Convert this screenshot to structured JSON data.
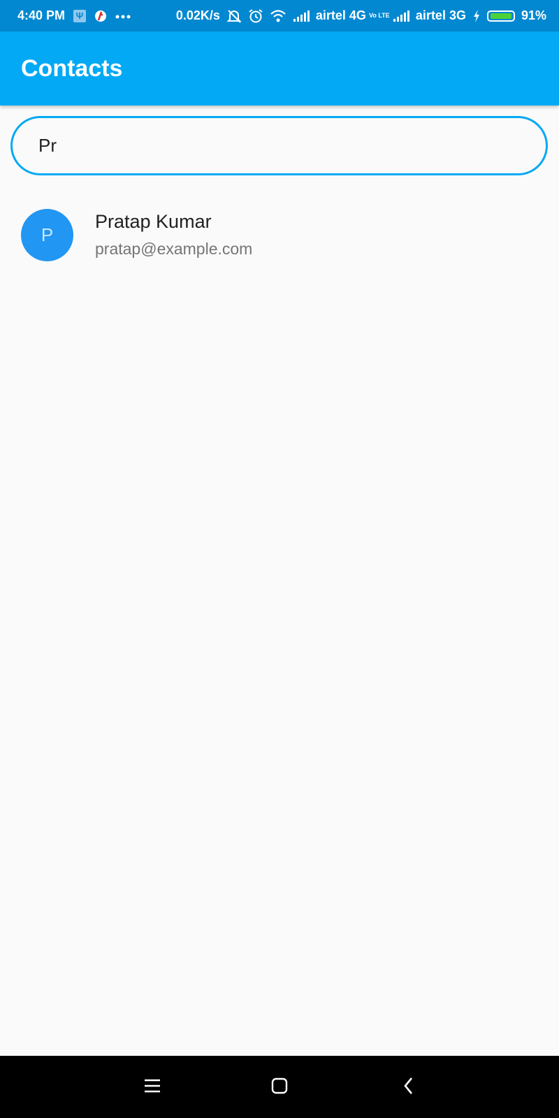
{
  "status_bar": {
    "time": "4:40 PM",
    "usb_glyph": "Ψ",
    "network_speed": "0.02K/s",
    "carrier1": "airtel 4G",
    "lte_badge": "Vo LTE",
    "carrier2": "airtel 3G",
    "battery_percent": "91%",
    "battery_level": 0.91,
    "icons": [
      "usb-icon",
      "app-notification-icon",
      "more-dots-icon",
      "mute-icon",
      "alarm-icon",
      "wifi-icon",
      "signal-icon",
      "volte-icon",
      "signal-icon",
      "charging-icon",
      "battery-icon"
    ],
    "colors": {
      "background": "#0288d1",
      "battery_fill": "#4cd137"
    }
  },
  "app_bar": {
    "title": "Contacts",
    "color": "#03a9f4"
  },
  "search": {
    "value": "Pr",
    "border_color": "#03a9f4"
  },
  "contacts": [
    {
      "initial": "P",
      "name": "Pratap Kumar",
      "email": "pratap@example.com",
      "avatar_color": "#2196f3"
    }
  ],
  "nav_bar": {
    "icons": [
      "menu-icon",
      "home-icon",
      "back-icon"
    ]
  }
}
